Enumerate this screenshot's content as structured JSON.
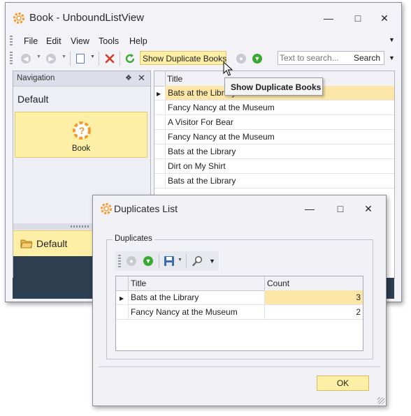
{
  "main_window": {
    "title": "Book - UnboundListView",
    "menu": [
      "File",
      "Edit",
      "View",
      "Tools",
      "Help"
    ],
    "toolbar": {
      "show_duplicates_label": "Show Duplicate Books",
      "search_placeholder": "Text to search...",
      "search_button": "Search"
    },
    "tooltip": "Show Duplicate Books",
    "navigation": {
      "header": "Navigation",
      "group": "Default",
      "item": "Book",
      "footer_group": "Default"
    },
    "grid": {
      "column": "Title",
      "rows": [
        "Bats at the Library",
        "Fancy Nancy at the Museum",
        "A Visitor For Bear",
        "Fancy Nancy at the Museum",
        "Bats at the Library",
        "Dirt on My Shirt",
        "Bats at the Library"
      ]
    }
  },
  "dialog": {
    "title": "Duplicates List",
    "group_label": "Duplicates",
    "columns": [
      "Title",
      "Count"
    ],
    "rows": [
      {
        "title": "Bats at the Library",
        "count": "3"
      },
      {
        "title": "Fancy Nancy at the Museum",
        "count": "2"
      }
    ],
    "ok_button": "OK"
  },
  "colors": {
    "accent_yellow": "#fdf0a6",
    "selection_row": "#fbe6a8",
    "title_icon": "#f29a2e",
    "red_x": "#d23a2a",
    "green": "#3ca834"
  }
}
